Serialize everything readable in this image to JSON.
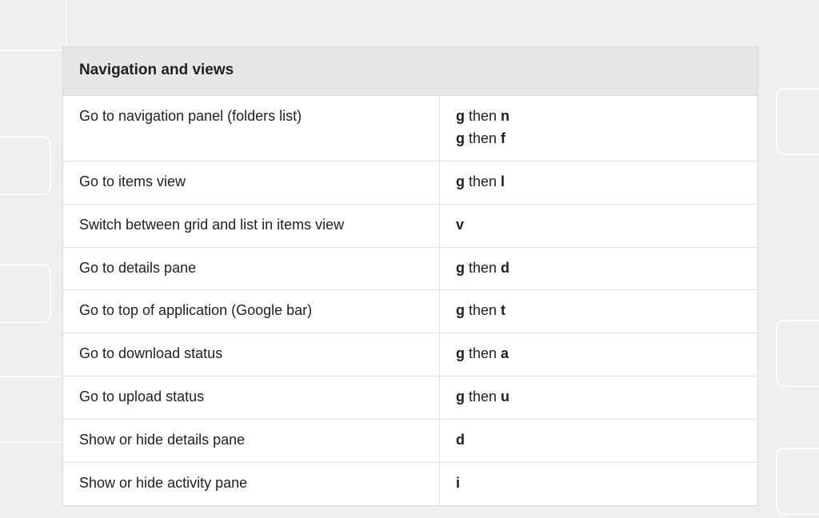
{
  "section": {
    "title": "Navigation and views"
  },
  "rows": [
    {
      "label": "Go to navigation panel (folders list)",
      "shortcuts": [
        [
          {
            "t": "k",
            "v": "g"
          },
          {
            "t": "sep",
            "v": " then "
          },
          {
            "t": "k",
            "v": "n"
          }
        ],
        [
          {
            "t": "k",
            "v": "g"
          },
          {
            "t": "sep",
            "v": " then "
          },
          {
            "t": "k",
            "v": "f"
          }
        ]
      ]
    },
    {
      "label": "Go to items view",
      "shortcuts": [
        [
          {
            "t": "k",
            "v": "g"
          },
          {
            "t": "sep",
            "v": " then "
          },
          {
            "t": "k",
            "v": "l"
          }
        ]
      ]
    },
    {
      "label": "Switch between grid and list in items view",
      "shortcuts": [
        [
          {
            "t": "k",
            "v": "v"
          }
        ]
      ]
    },
    {
      "label": "Go to details pane",
      "shortcuts": [
        [
          {
            "t": "k",
            "v": "g"
          },
          {
            "t": "sep",
            "v": " then "
          },
          {
            "t": "k",
            "v": "d"
          }
        ]
      ]
    },
    {
      "label": "Go to top of application (Google bar)",
      "shortcuts": [
        [
          {
            "t": "k",
            "v": "g"
          },
          {
            "t": "sep",
            "v": " then "
          },
          {
            "t": "k",
            "v": "t"
          }
        ]
      ]
    },
    {
      "label": "Go to download status",
      "shortcuts": [
        [
          {
            "t": "k",
            "v": "g"
          },
          {
            "t": "sep",
            "v": " then "
          },
          {
            "t": "k",
            "v": "a"
          }
        ]
      ]
    },
    {
      "label": "Go to upload status",
      "shortcuts": [
        [
          {
            "t": "k",
            "v": "g"
          },
          {
            "t": "sep",
            "v": " then "
          },
          {
            "t": "k",
            "v": "u"
          }
        ]
      ]
    },
    {
      "label": "Show or hide details pane",
      "shortcuts": [
        [
          {
            "t": "k",
            "v": "d"
          }
        ]
      ]
    },
    {
      "label": "Show or hide activity pane",
      "shortcuts": [
        [
          {
            "t": "k",
            "v": "i"
          }
        ]
      ]
    }
  ]
}
